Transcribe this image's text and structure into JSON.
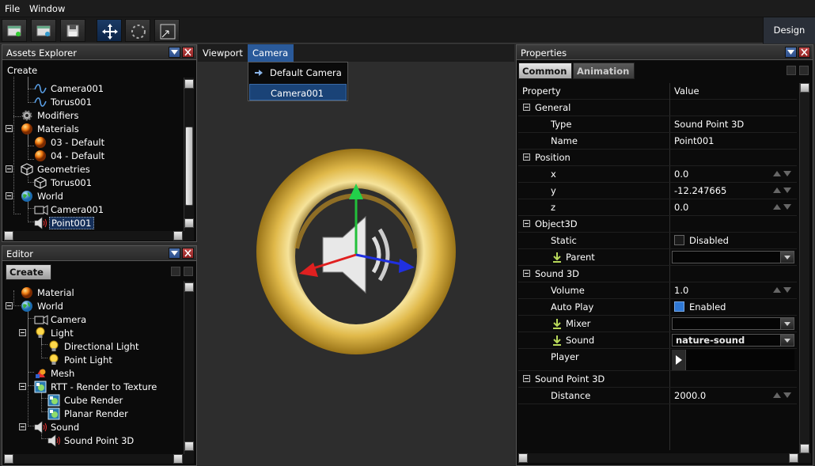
{
  "menubar": {
    "file": "File",
    "window": "Window"
  },
  "toolbar": {
    "design_label": "Design"
  },
  "assets_explorer": {
    "title": "Assets Explorer",
    "create_label": "Create",
    "items": [
      {
        "label": "Camera001",
        "icon": "curve-icon"
      },
      {
        "label": "Torus001",
        "icon": "curve-icon"
      },
      {
        "label": "Modifiers",
        "icon": "gear-icon"
      },
      {
        "label": "Materials",
        "icon": "material-sphere-icon"
      },
      {
        "label": "03 - Default",
        "icon": "material-sphere-icon"
      },
      {
        "label": "04 - Default",
        "icon": "material-sphere-icon"
      },
      {
        "label": "Geometries",
        "icon": "cube-icon"
      },
      {
        "label": "Torus001",
        "icon": "cube-icon"
      },
      {
        "label": "World",
        "icon": "globe-icon"
      },
      {
        "label": "Camera001",
        "icon": "camera-icon"
      },
      {
        "label": "Point001",
        "icon": "speaker-icon"
      }
    ]
  },
  "editor": {
    "title": "Editor",
    "create_label": "Create",
    "items": [
      {
        "label": "Material",
        "icon": "material-sphere-icon"
      },
      {
        "label": "World",
        "icon": "globe-icon"
      },
      {
        "label": "Camera",
        "icon": "camera-icon"
      },
      {
        "label": "Light",
        "icon": "bulb-icon"
      },
      {
        "label": "Directional Light",
        "icon": "bulb-icon"
      },
      {
        "label": "Point Light",
        "icon": "bulb-icon"
      },
      {
        "label": "Mesh",
        "icon": "mesh-icon"
      },
      {
        "label": "RTT - Render to Texture",
        "icon": "render-icon"
      },
      {
        "label": "Cube Render",
        "icon": "render-icon"
      },
      {
        "label": "Planar Render",
        "icon": "render-icon"
      },
      {
        "label": "Sound",
        "icon": "speaker-icon"
      },
      {
        "label": "Sound Point 3D",
        "icon": "speaker-icon"
      }
    ]
  },
  "viewport": {
    "tab_viewport": "Viewport",
    "tab_camera": "Camera",
    "camera_menu": [
      "Default Camera",
      "Camera001"
    ]
  },
  "properties": {
    "title": "Properties",
    "tabs": [
      "Common",
      "Animation"
    ],
    "col_property": "Property",
    "col_value": "Value",
    "rows": [
      {
        "kind": "group",
        "label": "General"
      },
      {
        "kind": "prop",
        "label": "Type",
        "value": "Sound Point 3D"
      },
      {
        "kind": "prop",
        "label": "Name",
        "value": "Point001"
      },
      {
        "kind": "group",
        "label": "Position"
      },
      {
        "kind": "num",
        "label": "x",
        "value": "0.0"
      },
      {
        "kind": "num",
        "label": "y",
        "value": "-12.247665"
      },
      {
        "kind": "num",
        "label": "z",
        "value": "0.0"
      },
      {
        "kind": "group",
        "label": "Object3D"
      },
      {
        "kind": "check",
        "label": "Static",
        "value": "Disabled",
        "checked": false
      },
      {
        "kind": "combo",
        "label": "Parent",
        "value": ""
      },
      {
        "kind": "group",
        "label": "Sound 3D"
      },
      {
        "kind": "num",
        "label": "Volume",
        "value": "1.0"
      },
      {
        "kind": "check",
        "label": "Auto Play",
        "value": "Enabled",
        "checked": true
      },
      {
        "kind": "combo",
        "label": "Mixer",
        "value": ""
      },
      {
        "kind": "combo",
        "label": "Sound",
        "value": "nature-sound"
      },
      {
        "kind": "player",
        "label": "Player"
      },
      {
        "kind": "group",
        "label": "Sound Point 3D"
      },
      {
        "kind": "num",
        "label": "Distance",
        "value": "2000.0"
      }
    ]
  }
}
